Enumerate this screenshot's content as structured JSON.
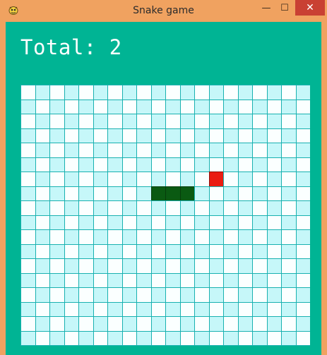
{
  "window": {
    "title": "Snake game",
    "app_icon": "pygame-snake-icon",
    "controls": {
      "minimize_glyph": "—",
      "maximize_glyph": "☐",
      "close_glyph": "✕"
    }
  },
  "score": {
    "text": "Total: 2",
    "label": "Total:",
    "value": 2
  },
  "board": {
    "columns": 20,
    "rows": 18,
    "colors": {
      "light_cell": "#fbffff",
      "cyan_cell": "#c6f7f9",
      "grid_line": "#19b1b0",
      "snake": "#0a5a12",
      "snake_border": "#063d0b",
      "food": "#ea1c12",
      "background": "#00b494"
    },
    "snake": [
      [
        9,
        7
      ],
      [
        10,
        7
      ],
      [
        11,
        7
      ]
    ],
    "food": [
      13,
      6
    ]
  }
}
